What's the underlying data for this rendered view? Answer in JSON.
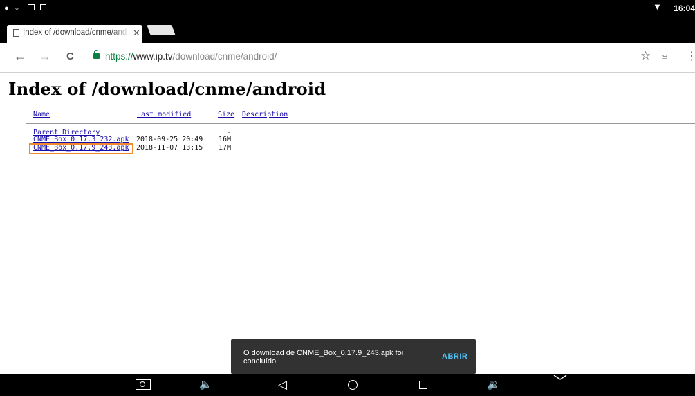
{
  "status_bar": {
    "time": "16:04",
    "icons": [
      "shield-icon",
      "download-done-icon",
      "image-icon",
      "app-icon",
      "wifi-icon"
    ]
  },
  "tab": {
    "title": "Index of /download/cnme/android/",
    "close_glyph": "✕"
  },
  "toolbar": {
    "back_glyph": "←",
    "forward_glyph": "→",
    "reload_glyph": "C",
    "url_scheme": "https://",
    "url_host": "www.ip.tv",
    "url_path": "/download/cnme/android/",
    "bookmark_glyph": "☆",
    "download_glyph": "⤓",
    "menu_glyph": "⋮"
  },
  "page": {
    "heading": "Index of /download/cnme/android",
    "columns": {
      "name": "Name",
      "last_modified": "Last modified",
      "size": "Size",
      "description": "Description"
    },
    "rows": [
      {
        "name": "Parent Directory",
        "modified": "",
        "size": "-"
      },
      {
        "name": "CNME_Box_0.17.3_232.apk",
        "modified": "2018-09-25 20:49",
        "size": "16M"
      },
      {
        "name": "CNME_Box_0.17.9_243.apk",
        "modified": "2018-11-07 13:15",
        "size": "17M"
      }
    ]
  },
  "snackbar": {
    "message": "O download de CNME_Box_0.17.9_243.apk foi concluído",
    "action": "ABRIR"
  },
  "nav_bar": {
    "volume_down_glyph": "🔈",
    "back_glyph": "◁",
    "volume_up_glyph": "🔉",
    "collapse_glyph": "﹀"
  },
  "colors": {
    "highlight": "#f08a2c",
    "link": "#1a0dab",
    "snackbar_action": "#4fc3f7",
    "lock": "#0b8043"
  }
}
